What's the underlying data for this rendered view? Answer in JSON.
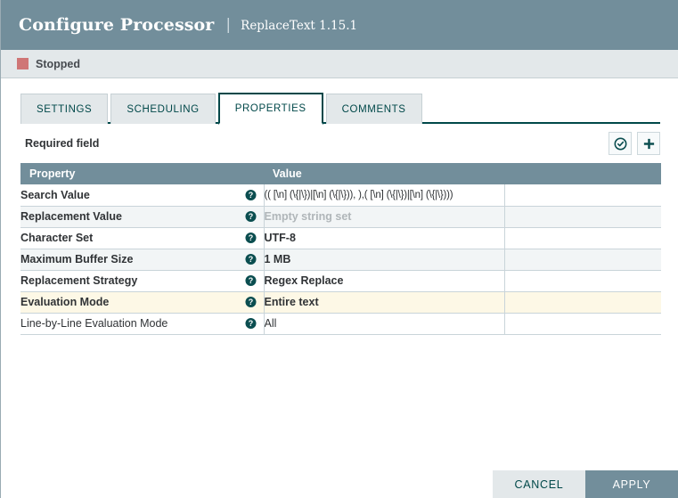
{
  "header": {
    "title": "Configure Processor",
    "separator": "|",
    "subtitle": "ReplaceText 1.15.1"
  },
  "status": {
    "label": "Stopped",
    "color": "#cf7676"
  },
  "tabs": [
    {
      "label": "SETTINGS",
      "active": false
    },
    {
      "label": "SCHEDULING",
      "active": false
    },
    {
      "label": "PROPERTIES",
      "active": true
    },
    {
      "label": "COMMENTS",
      "active": false
    }
  ],
  "toolbar": {
    "required_field_label": "Required field",
    "verify_icon": "check-circle-icon",
    "add_icon": "plus-icon"
  },
  "table": {
    "columns": [
      "Property",
      "Value",
      ""
    ],
    "rows": [
      {
        "property": "Search Value",
        "required": true,
        "value": "(( [\\n] (\\{|\\})|[\\n] (\\{|\\})), ),( [\\n] (\\{|\\})|[\\n] (\\{|\\})))",
        "value_style": "regex",
        "highlight": false
      },
      {
        "property": "Replacement Value",
        "required": true,
        "value": "Empty string set",
        "value_style": "empty",
        "highlight": false
      },
      {
        "property": "Character Set",
        "required": true,
        "value": "UTF-8",
        "value_style": "normal",
        "highlight": false
      },
      {
        "property": "Maximum Buffer Size",
        "required": true,
        "value": "1 MB",
        "value_style": "normal",
        "highlight": false
      },
      {
        "property": "Replacement Strategy",
        "required": true,
        "value": "Regex Replace",
        "value_style": "normal",
        "highlight": false
      },
      {
        "property": "Evaluation Mode",
        "required": true,
        "value": "Entire text",
        "value_style": "normal",
        "highlight": true
      },
      {
        "property": "Line-by-Line Evaluation Mode",
        "required": false,
        "value": "All",
        "value_style": "not-bold",
        "highlight": false
      }
    ],
    "help_icon": "help-circle-icon"
  },
  "footer": {
    "cancel_label": "CANCEL",
    "apply_label": "APPLY"
  },
  "colors": {
    "header_bg": "#728e9b",
    "accent": "#004849",
    "status_stopped": "#cf7676",
    "highlight_row": "#fdf8e6"
  }
}
